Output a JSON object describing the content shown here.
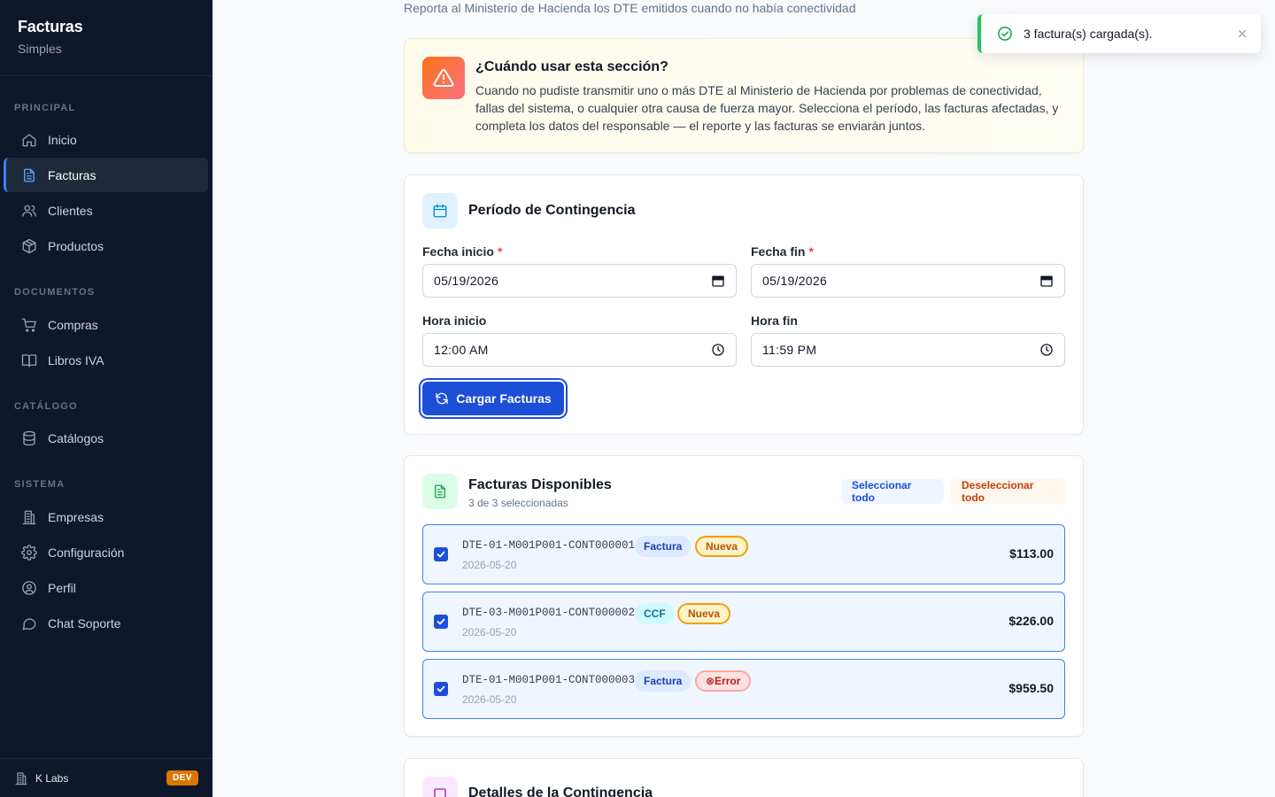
{
  "sidebar": {
    "brand_title": "Facturas",
    "brand_subtitle": "Simples",
    "sections": [
      "PRINCIPAL",
      "DOCUMENTOS",
      "CATÁLOGO",
      "SISTEMA"
    ],
    "items": [
      {
        "label": "Inicio",
        "icon": "home-icon"
      },
      {
        "label": "Facturas",
        "icon": "file-text-icon",
        "active": true
      },
      {
        "label": "Clientes",
        "icon": "users-icon"
      },
      {
        "label": "Productos",
        "icon": "package-icon"
      },
      {
        "label": "Compras",
        "icon": "cart-icon"
      },
      {
        "label": "Libros IVA",
        "icon": "book-icon"
      },
      {
        "label": "Catálogos",
        "icon": "database-icon"
      },
      {
        "label": "Empresas",
        "icon": "building-icon"
      },
      {
        "label": "Configuración",
        "icon": "gear-icon"
      },
      {
        "label": "Perfil",
        "icon": "user-circle-icon"
      },
      {
        "label": "Chat Soporte",
        "icon": "chat-icon"
      }
    ],
    "footer_company": "K Labs",
    "footer_badge": "DEV"
  },
  "header": {
    "subtitle": "Reporta al Ministerio de Hacienda los DTE emitidos cuando no había conectividad"
  },
  "info": {
    "title": "¿Cuándo usar esta sección?",
    "text": "Cuando no pudiste transmitir uno o más DTE al Ministerio de Hacienda por problemas de conectividad, fallas del sistema, o cualquier otra causa de fuerza mayor. Selecciona el período, las facturas afectadas, y completa los datos del responsable — el reporte y las facturas se enviarán juntos."
  },
  "periodo": {
    "title": "Período de Contingencia",
    "fecha_inicio_label": "Fecha inicio",
    "fecha_inicio_value": "05/19/2026",
    "fecha_fin_label": "Fecha fin",
    "fecha_fin_value": "05/19/2026",
    "hora_inicio_label": "Hora inicio",
    "hora_inicio_value": "12:00 AM",
    "hora_fin_label": "Hora fin",
    "hora_fin_value": "11:59 PM",
    "required_mark": "*",
    "load_button": "Cargar Facturas"
  },
  "facturas": {
    "title": "Facturas Disponibles",
    "subtitle": "3 de 3 seleccionadas",
    "select_all": "Seleccionar todo",
    "deselect_all": "Deseleccionar todo",
    "rows": [
      {
        "code": "DTE-01-M001P001-CONT000001",
        "type": "Factura",
        "status": "Nueva",
        "date": "2026-05-20",
        "amount": "$113.00",
        "checked": true
      },
      {
        "code": "DTE-03-M001P001-CONT000002",
        "type": "CCF",
        "status": "Nueva",
        "date": "2026-05-20",
        "amount": "$226.00",
        "checked": true
      },
      {
        "code": "DTE-01-M001P001-CONT000003",
        "type": "Factura",
        "status": "⊗Error",
        "date": "2026-05-20",
        "amount": "$959.50",
        "checked": true
      }
    ]
  },
  "detalles": {
    "title": "Detalles de la Contingencia"
  },
  "toast": {
    "message": "3 factura(s) cargada(s)."
  },
  "colors": {
    "sidebar_bg": "#0f172a",
    "accent": "#1d4ed8",
    "success": "#22c55e",
    "warning": "#f59e0b",
    "error": "#ef4444"
  }
}
